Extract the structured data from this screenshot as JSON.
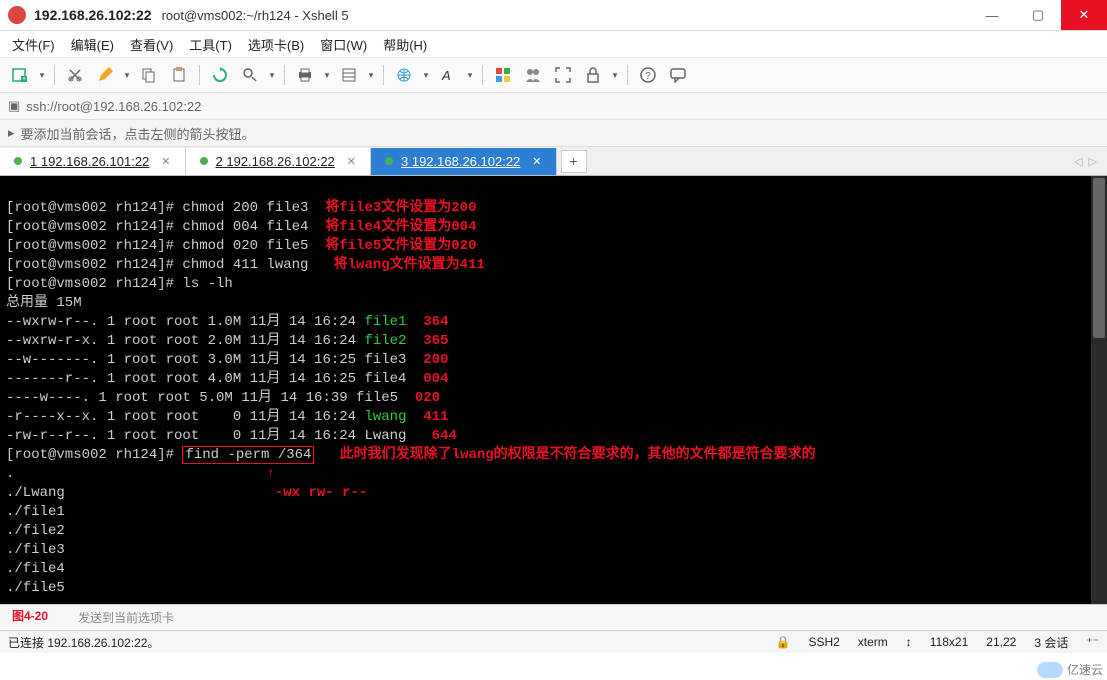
{
  "window": {
    "title": "192.168.26.102:22",
    "subtitle": "root@vms002:~/rh124 - Xshell 5"
  },
  "window_buttons": {
    "min": "—",
    "max": "▢",
    "close": "✕"
  },
  "menu": {
    "file": "文件(F)",
    "edit": "编辑(E)",
    "view": "查看(V)",
    "tools": "工具(T)",
    "tab": "选项卡(B)",
    "window": "窗口(W)",
    "help": "帮助(H)"
  },
  "address": {
    "scheme": "ssh://root@192.168.26.102:22"
  },
  "hint": {
    "text": "要添加当前会话，点击左侧的箭头按钮。"
  },
  "tabs": {
    "items": [
      {
        "label": "1 192.168.26.101:22"
      },
      {
        "label": "2 192.168.26.102:22"
      },
      {
        "label": "3 192.168.26.102:22"
      }
    ],
    "new": "+",
    "arrows": {
      "left": "◁",
      "right": "▷"
    }
  },
  "term": {
    "l1": "[root@vms002 rh124]# chmod 200 file3",
    "a1": "  将file3文件设置为200",
    "l2": "[root@vms002 rh124]# chmod 004 file4",
    "a2": "  将file4文件设置为004",
    "l3": "[root@vms002 rh124]# chmod 020 file5",
    "a3": "  将file5文件设置为020",
    "l4": "[root@vms002 rh124]# chmod 411 lwang",
    "a4": "   将lwang文件设置为411",
    "l5": "[root@vms002 rh124]# ls -lh",
    "l6": "总用量 15M",
    "r1a": "--wxrw-r--. 1 root root 1.0M 11月 14 16:24 ",
    "r1f": "file1",
    "r1p": "  364",
    "r2a": "--wxrw-r-x. 1 root root 2.0M 11月 14 16:24 ",
    "r2f": "file2",
    "r2p": "  365",
    "r3a": "--w-------. 1 root root 3.0M 11月 14 16:25 file3",
    "r3p": "  200",
    "r4a": "-------r--. 1 root root 4.0M 11月 14 16:25 file4",
    "r4p": "  004",
    "r5a": "----w----. 1 root root 5.0M 11月 14 16:39 file5",
    "r5p": "  020",
    "r6a": "-r----x--x. 1 root root    0 11月 14 16:24 ",
    "r6f": "lwang",
    "r6p": "  411",
    "r7a": "-rw-r--r--. 1 root root    0 11月 14 16:24 Lwang",
    "r7p": "   644",
    "p1": "[root@vms002 rh124]# ",
    "cmd": "find -perm /364",
    "note": "   此时我们发现除了lwang的权限是不符合要求的，其他的文件都是符合要求的",
    "arrow": "                              ↑",
    "perm": "                         -wx rw- r--",
    "o0": ".",
    "o1": "./Lwang",
    "o2": "./file1",
    "o3": "./file2",
    "o4": "./file3",
    "o5": "./file4",
    "o6": "./file5"
  },
  "send": {
    "text": "发送到当前选项卡",
    "fig": "图4-20"
  },
  "status": {
    "conn": "已连接 192.168.26.102:22。",
    "proto": "SSH2",
    "termtype": "xterm",
    "size": "118x21",
    "cursor": "21,22",
    "sessions": "3 会话",
    "lock": "🔒",
    "updown": "↕",
    "plusminus": "⁺⁻"
  },
  "watermark": {
    "text": "亿速云"
  }
}
